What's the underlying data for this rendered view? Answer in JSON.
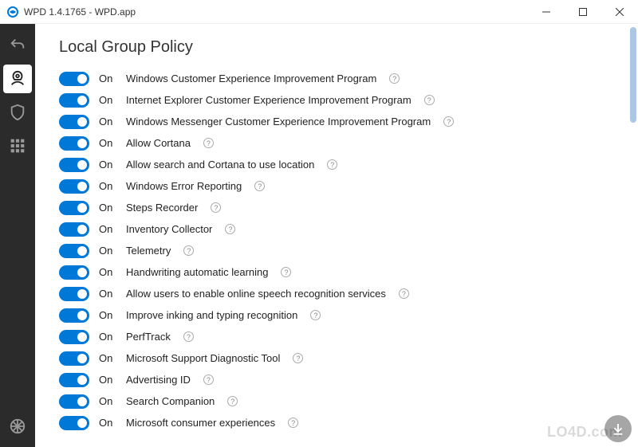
{
  "titlebar": {
    "title": "WPD 1.4.1765 - WPD.app"
  },
  "main": {
    "section_title": "Local Group Policy",
    "toggle_state_label": "On",
    "policies": [
      {
        "label": "Windows Customer Experience Improvement Program"
      },
      {
        "label": "Internet Explorer Customer Experience Improvement Program"
      },
      {
        "label": "Windows Messenger Customer Experience Improvement Program"
      },
      {
        "label": "Allow Cortana"
      },
      {
        "label": "Allow search and Cortana to use location"
      },
      {
        "label": "Windows Error Reporting"
      },
      {
        "label": "Steps Recorder"
      },
      {
        "label": "Inventory Collector"
      },
      {
        "label": "Telemetry"
      },
      {
        "label": "Handwriting automatic learning"
      },
      {
        "label": "Allow users to enable online speech recognition services"
      },
      {
        "label": "Improve inking and typing recognition"
      },
      {
        "label": "PerfTrack"
      },
      {
        "label": "Microsoft Support Diagnostic Tool"
      },
      {
        "label": "Advertising ID"
      },
      {
        "label": "Search Companion"
      },
      {
        "label": "Microsoft consumer experiences"
      }
    ]
  },
  "watermark": "LO4D.com"
}
